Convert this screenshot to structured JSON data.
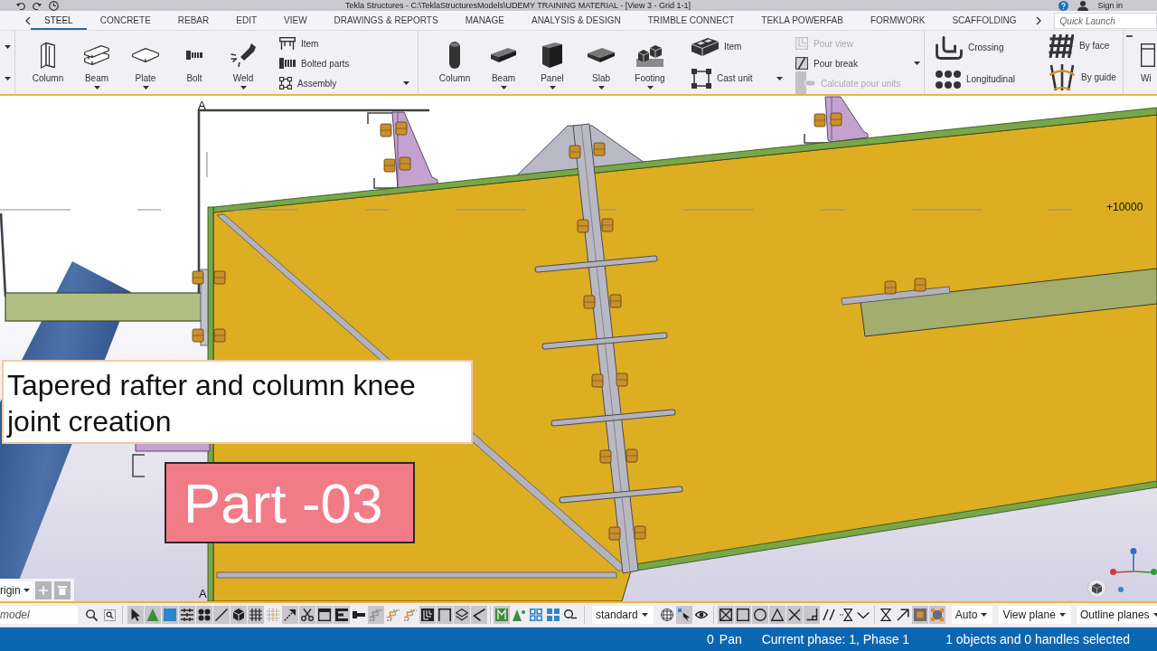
{
  "window": {
    "title": "Tekla Structures - C:\\TeklaStructuresModels\\UDEMY TRAINING MATERIAL - [View 3 - Grid 1-1]",
    "sign_in": "Sign in"
  },
  "ribbon_tabs": [
    {
      "label": "STEEL",
      "selected": true
    },
    {
      "label": "CONCRETE",
      "selected": false
    },
    {
      "label": "REBAR",
      "selected": false
    },
    {
      "label": "EDIT",
      "selected": false
    },
    {
      "label": "VIEW",
      "selected": false
    },
    {
      "label": "DRAWINGS & REPORTS",
      "selected": false
    },
    {
      "label": "MANAGE",
      "selected": false
    },
    {
      "label": "ANALYSIS & DESIGN",
      "selected": false
    },
    {
      "label": "TRIMBLE CONNECT",
      "selected": false
    },
    {
      "label": "TEKLA POWERFAB",
      "selected": false
    },
    {
      "label": "FORMWORK",
      "selected": false
    },
    {
      "label": "SCAFFOLDING",
      "selected": false
    }
  ],
  "quick_launch": {
    "placeholder": "Quick Launch"
  },
  "ribbon_groups": [
    {
      "stacks": [
        {
          "items": [
            {
              "has_menu": true
            },
            {
              "has_menu": true
            }
          ]
        }
      ]
    },
    {
      "large": [
        {
          "label": "Column",
          "has_menu": false
        },
        {
          "label": "Beam",
          "has_menu": true
        },
        {
          "label": "Plate",
          "has_menu": true
        },
        {
          "label": "Bolt",
          "has_menu": false
        },
        {
          "label": "Weld",
          "has_menu": true
        }
      ],
      "stacks": [
        {
          "items": [
            {
              "label": "Item",
              "disabled": false,
              "has_menu": false
            },
            {
              "label": "Bolted parts",
              "disabled": false,
              "has_menu": false
            },
            {
              "label": "Assembly",
              "disabled": false,
              "has_menu": true
            }
          ]
        }
      ]
    },
    {
      "large": [
        {
          "label": "Column",
          "has_menu": false
        },
        {
          "label": "Beam",
          "has_menu": true
        },
        {
          "label": "Panel",
          "has_menu": true
        },
        {
          "label": "Slab",
          "has_menu": true
        },
        {
          "label": "Footing",
          "has_menu": true
        }
      ],
      "stacks": [
        {
          "items": [
            {
              "label": "Item",
              "disabled": false,
              "has_menu": false
            },
            {
              "label": "Cast unit",
              "disabled": false,
              "has_menu": true
            }
          ]
        },
        {
          "items": [
            {
              "label": "Pour view",
              "disabled": true,
              "has_menu": false
            },
            {
              "label": "Pour break",
              "disabled": false,
              "has_menu": true
            },
            {
              "label": "Calculate pour units",
              "disabled": true,
              "has_menu": false
            }
          ]
        }
      ]
    },
    {
      "stacks": [
        {
          "items": [
            {
              "label": "Crossing",
              "disabled": false,
              "has_menu": false
            },
            {
              "label": "Longitudinal",
              "disabled": false,
              "has_menu": false
            }
          ]
        },
        {
          "items": [
            {
              "label": "By face",
              "disabled": false,
              "has_menu": false
            },
            {
              "label": "By guide",
              "disabled": false,
              "has_menu": false
            }
          ]
        }
      ]
    },
    {
      "large": [
        {
          "label": "Wi",
          "has_menu": false
        }
      ]
    }
  ],
  "viewport": {
    "section_labels": [
      "A",
      "A"
    ],
    "elevation_label": "+10000",
    "origin": "rigin",
    "plane_buttons": [
      {
        "disabled": true
      },
      {
        "disabled": true
      }
    ]
  },
  "overlay": {
    "caption": "Tapered rafter and column knee joint creation",
    "part_label": "Part -03"
  },
  "toolbar": {
    "search": {
      "placeholder": "model"
    },
    "selection_switches": [
      {
        "on": true
      },
      {
        "on": true
      },
      {
        "on": true
      },
      {
        "on": true
      },
      {
        "on": true
      },
      {
        "on": true
      },
      {
        "on": true
      },
      {
        "on": true
      },
      {
        "on": false
      },
      {
        "on": true
      },
      {
        "on": true
      },
      {
        "on": true
      },
      {
        "on": true
      },
      {
        "on": false
      },
      {
        "on": true
      },
      {
        "on": false
      },
      {
        "on": false
      },
      {
        "on": true
      },
      {
        "on": true
      },
      {
        "on": true
      },
      {
        "on": true
      }
    ],
    "extra_switches": [
      {
        "on": true
      },
      {
        "on": false
      },
      {
        "on": false
      },
      {
        "on": false
      },
      {
        "on": false
      }
    ],
    "filter": "standard",
    "view_switches": [
      {
        "on": false
      },
      {
        "on": true
      },
      {
        "on": false
      }
    ],
    "snap_switches": [
      {
        "on": true
      },
      {
        "on": true
      },
      {
        "on": true
      },
      {
        "on": true
      },
      {
        "on": true
      },
      {
        "on": true
      },
      {
        "on": false
      },
      {
        "on": false
      },
      {
        "on": false
      }
    ],
    "snap_extra": [
      {
        "on": false
      },
      {
        "on": false
      },
      {
        "on": true
      },
      {
        "on": true
      }
    ],
    "dropdowns": [
      "Auto",
      "View plane",
      "Outline planes"
    ]
  },
  "status_bar": {
    "count": "0",
    "mode": "Pan",
    "phase": "Current phase: 1, Phase 1",
    "selection": "1 objects and 0 handles selected"
  }
}
